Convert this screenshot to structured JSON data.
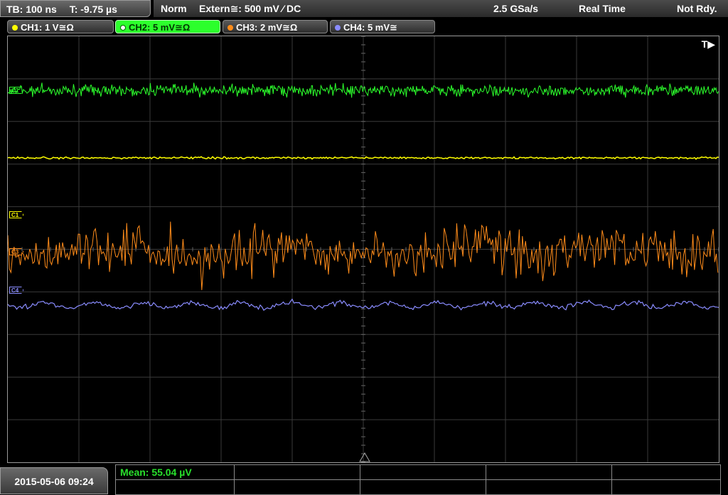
{
  "header": {
    "timebase": "TB: 100 ns",
    "trigger_time": "T: -9.75 µs",
    "mode": "Norm",
    "trigger": "Extern≅: 500 mV ⁄ DC",
    "sample_rate": "2.5 GSa/s",
    "acq_mode": "Real Time",
    "status": "Not Rdy."
  },
  "channels": [
    {
      "label": "CH1: 1 V≅Ω",
      "color": "#ffff00",
      "active": false
    },
    {
      "label": "CH2: 5 mV≅Ω",
      "color": "#2cff2c",
      "active": true
    },
    {
      "label": "CH3: 2 mV≅Ω",
      "color": "#ff8c1a",
      "active": false
    },
    {
      "label": "CH4: 5 mV≅",
      "color": "#8080ff",
      "active": false
    }
  ],
  "markers": {
    "c1": "C1",
    "c2": "C2",
    "c3": "C3",
    "c4": "C4",
    "trigger": "T▶"
  },
  "measurement": {
    "mean": "Mean: 55.04 µV"
  },
  "datetime": "2015-05-06 09:24",
  "colors": {
    "ch1": "#ffff00",
    "ch2": "#2cff2c",
    "ch3": "#ff8c1a",
    "ch4": "#8a8cff",
    "grid": "#3a3a3a",
    "panel": "#4a4a4a"
  }
}
